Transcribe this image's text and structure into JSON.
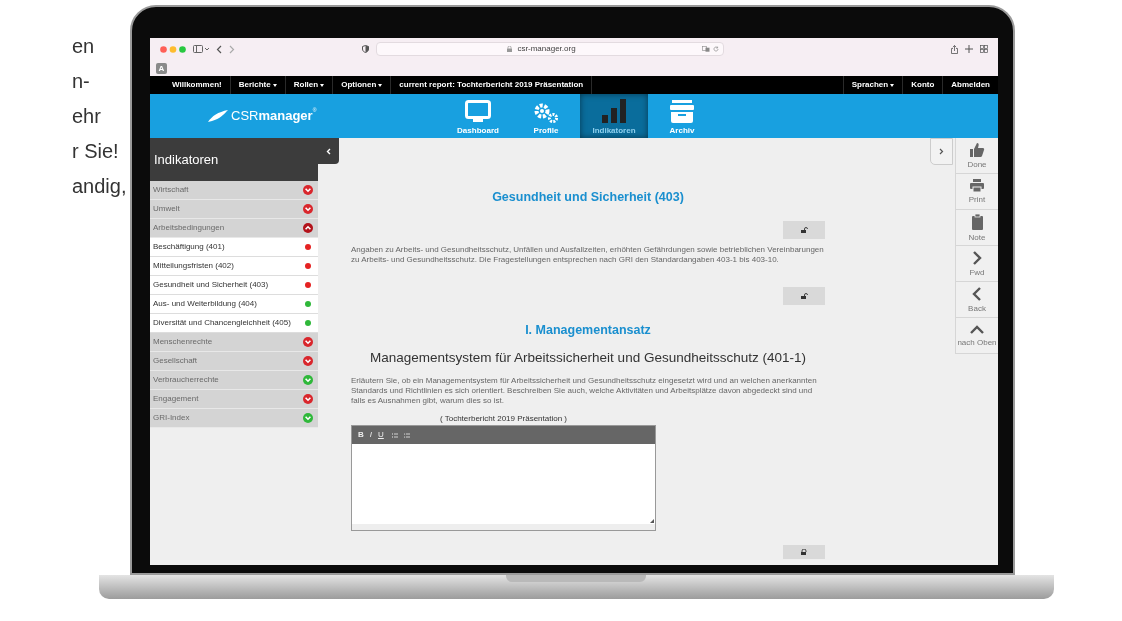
{
  "side_text": [
    "en",
    "n-",
    "ehr",
    "r Sie!",
    "andig,"
  ],
  "browser": {
    "url": "csr-manager.org",
    "tab_letter": "A"
  },
  "top_nav": {
    "left": [
      {
        "label": "Willkommen!",
        "dropdown": false
      },
      {
        "label": "Berichte",
        "dropdown": true
      },
      {
        "label": "Rollen",
        "dropdown": true
      },
      {
        "label": "Optionen",
        "dropdown": true
      },
      {
        "label": "current report: Tochterbericht 2019 Präsentation",
        "dropdown": false
      }
    ],
    "right": [
      {
        "label": "Sprachen",
        "dropdown": true
      },
      {
        "label": "Konto",
        "dropdown": false
      },
      {
        "label": "Abmelden",
        "dropdown": false
      }
    ]
  },
  "header": {
    "logo_text": "CSR",
    "logo_bold": "manager",
    "logo_mark": "®",
    "tabs": [
      {
        "label": "Dashboard",
        "kind": "monitor",
        "selected": false
      },
      {
        "label": "Profile",
        "kind": "gears",
        "selected": false
      },
      {
        "label": "Indikatoren",
        "kind": "chart",
        "selected": true
      },
      {
        "label": "Archiv",
        "kind": "archive",
        "selected": false
      }
    ]
  },
  "sidebar": {
    "title": "Indikatoren",
    "items": [
      {
        "label": "Wirtschaft",
        "color": "#d9262c",
        "expanded": false
      },
      {
        "label": "Umwelt",
        "color": "#d9262c",
        "expanded": false
      },
      {
        "label": "Arbeitsbedingungen",
        "color": "#b3131b",
        "expanded": true,
        "children": [
          {
            "label": "Beschäftigung (401)",
            "color": "#e52222"
          },
          {
            "label": "Mitteilungsfristen (402)",
            "color": "#e52222"
          },
          {
            "label": "Gesundheit und Sicherheit (403)",
            "color": "#e52222"
          },
          {
            "label": "Aus- und Weiterbildung (404)",
            "color": "#2fb83a"
          },
          {
            "label": "Diversität und Chancengleichheit (405)",
            "color": "#2fb83a"
          }
        ]
      },
      {
        "label": "Menschenrechte",
        "color": "#d9262c",
        "expanded": false
      },
      {
        "label": "Gesellschaft",
        "color": "#d9262c",
        "expanded": false
      },
      {
        "label": "Verbraucherrechte",
        "color": "#2fb83a",
        "expanded": false
      },
      {
        "label": "Engagement",
        "color": "#d9262c",
        "expanded": false
      },
      {
        "label": "GRI-Index",
        "color": "#2fb83a",
        "expanded": false
      }
    ]
  },
  "content": [
    {
      "kind": "title",
      "text": "Gesundheit und Sicherheit (403)"
    },
    {
      "kind": "lock",
      "locked": false
    },
    {
      "kind": "paragraph",
      "text": "Angaben zu Arbeits- und Gesundheitsschutz, Unfällen und Ausfallzeiten, erhöhten Gefährdungen sowie betrieblichen Vereinbarungen zu Arbeits- und Gesundheitsschutz. Die Fragestellungen entsprechen nach GRI den Standardangaben 403-1 bis 403-10."
    },
    {
      "kind": "lock",
      "locked": false
    },
    {
      "kind": "section",
      "text": "I. Managementansatz"
    },
    {
      "kind": "subtitle",
      "text": "Managementsystem für Arbeitssicherheit und Gesundheitsschutz (401-1)"
    },
    {
      "kind": "paragraph",
      "text": "Erläutern Sie, ob ein Managementsystem für Arbeitssicherheit und Gesundheitsschutz eingesetzt wird und an welchen anerkannten Standards und Richtlinien es sich orientiert. Beschreiben Sie auch, welche Aktivitäten und Arbeitsplätze davon abgedeckt sind und falls es Ausnahmen gibt, warum dies so ist."
    },
    {
      "kind": "editor",
      "label": "( Tochterbericht 2019 Präsentation )",
      "buttons": [
        "B",
        "I",
        "U"
      ]
    },
    {
      "kind": "lock",
      "locked": true
    }
  ],
  "toolbar": [
    {
      "label": "Done",
      "kind": "done"
    },
    {
      "label": "Print",
      "kind": "print"
    },
    {
      "label": "Note",
      "kind": "note"
    },
    {
      "label": "Fwd",
      "kind": "fwd"
    },
    {
      "label": "Back",
      "kind": "back"
    },
    {
      "label": "nach Oben",
      "kind": "top"
    }
  ]
}
